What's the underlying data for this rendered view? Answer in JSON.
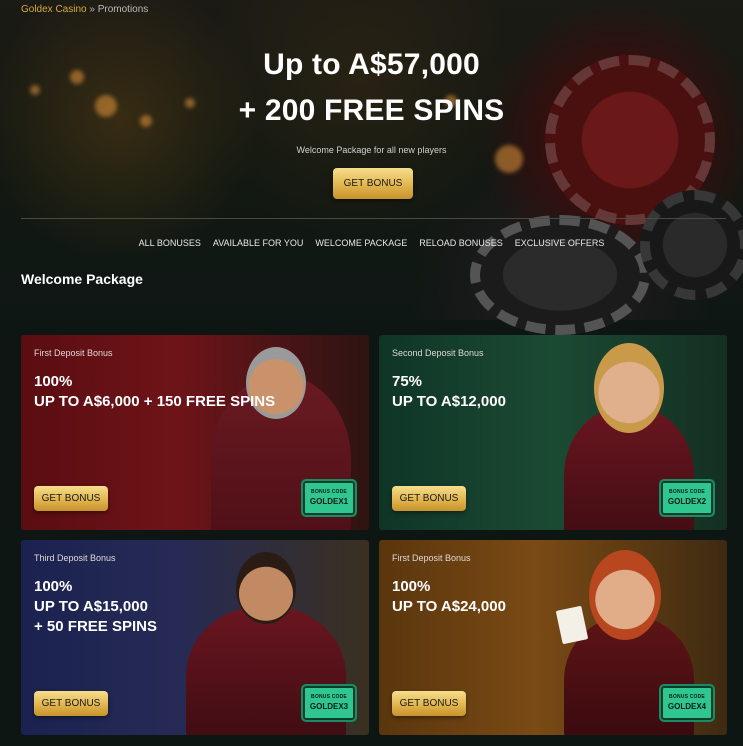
{
  "breadcrumb": {
    "home": "Goldex Casino",
    "separator": " » ",
    "current": "Promotions"
  },
  "hero": {
    "title_line1": "Up to A$57,000",
    "title_line2": "+ 200 FREE SPINS",
    "subtitle": "Welcome Package for all new players",
    "cta": "GET BONUS"
  },
  "filters": [
    "ALL BONUSES",
    "AVAILABLE FOR YOU",
    "WELCOME PACKAGE",
    "RELOAD BONUSES",
    "EXCLUSIVE OFFERS"
  ],
  "section_title": "Welcome Package",
  "cards": [
    {
      "label": "First Deposit Bonus",
      "headline": "100%\nUP TO A$6,000 + 150 FREE SPINS",
      "cta": "GET BONUS",
      "code_caption": "BONUS CODE",
      "code": "GOLDEX1"
    },
    {
      "label": "Second Deposit Bonus",
      "headline": "75%\nUP TO A$12,000",
      "cta": "GET BONUS",
      "code_caption": "BONUS CODE",
      "code": "GOLDEX2"
    },
    {
      "label": "Third Deposit Bonus",
      "headline": "100%\nUP TO A$15,000\n+ 50 FREE SPINS",
      "cta": "GET BONUS",
      "code_caption": "BONUS CODE",
      "code": "GOLDEX3"
    },
    {
      "label": "First Deposit Bonus",
      "headline": "100%\nUP TO A$24,000",
      "cta": "GET BONUS",
      "code_caption": "BONUS CODE",
      "code": "GOLDEX4"
    }
  ],
  "colors": {
    "accent_gold": "#e2b54f",
    "badge_green": "#2fc78f",
    "background": "#0d1613"
  }
}
